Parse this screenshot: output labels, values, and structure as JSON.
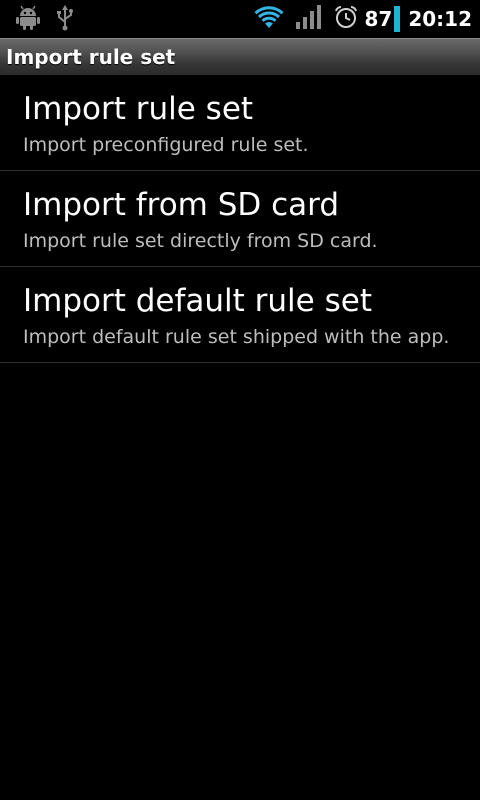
{
  "status_bar": {
    "left_icons": [
      "android-debug-icon",
      "usb-icon"
    ],
    "right_icons": [
      "wifi-icon",
      "signal-icon",
      "alarm-icon"
    ],
    "battery": "87",
    "time": "20:12",
    "battery_color": "#1fb3d9"
  },
  "title_bar": {
    "title": "Import rule set"
  },
  "list": {
    "items": [
      {
        "title": "Import rule set",
        "summary": "Import preconfigured rule set."
      },
      {
        "title": "Import from SD card",
        "summary": "Import rule set directly from SD card."
      },
      {
        "title": "Import default rule set",
        "summary": "Import default rule set shipped with the app."
      }
    ]
  }
}
